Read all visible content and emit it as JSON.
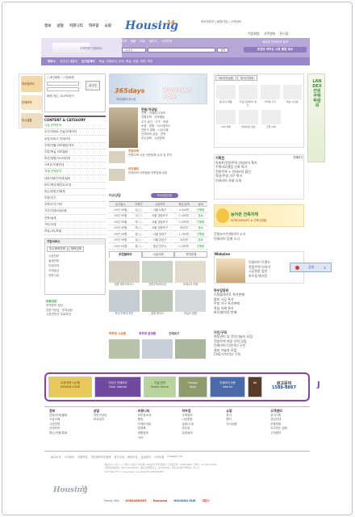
{
  "header": {
    "nav": [
      "정보",
      "상담",
      "커뮤니티",
      "하우징",
      "쇼핑"
    ],
    "top_links": "하우징투어 | 회원가입 | 고객센터",
    "logo_text": "Housing",
    "logo_num": "14",
    "links2": [
      "기업회원",
      "고객센터",
      "전시장"
    ],
    "search_tabs": [
      "자재",
      "샘플",
      "도로",
      "갤러리",
      "시공업체"
    ],
    "search_select": "시공검색",
    "search_button": "검색",
    "band_left": "주택전문 인테리어",
    "band_right_line1": "새로운 인테리어 정보",
    "band_right_line2": "조건만 바꾸는 시장 종합 보수",
    "sub_tabs": [
      "하우스",
      "국내 신 개발지",
      "인기검색어"
    ],
    "sub_keywords": "욕실, 인테리어, 도어, 욕실, 타일, 마루, 벽지"
  },
  "quick": {
    "items": [
      "하우징투어",
      "인테리어",
      "전시샘플"
    ]
  },
  "login": {
    "opt1": "개인회원",
    "opt2": "기업회원",
    "login_btn": "로그인",
    "join": "회원가입",
    "find": "ID/PW찾기"
  },
  "category": {
    "title": "CONTENT & CATEGORY",
    "items": [
      "시공 견적문의",
      "주거/아파트 건설/인테리어",
      "상업/오피스 인테리어",
      "주택/건물 리모델링/개조",
      "주방/욕실 리모델링",
      "외관/정원/익스테리어",
      "스토리 이용안내",
      "자재 견적문의",
      "내부자재/건자재/설비",
      "바닥/벽지/페인트/도장",
      "방수/방한/단열재",
      "조명/전기",
      "주택/주거/기타",
      "가구/인테리어소품",
      "건축/설계",
      "기타/자재",
      "커뮤니티/포럼"
    ]
  },
  "partner": {
    "title": "기업서비스",
    "tabs": [
      "우수협력업체",
      "협력업체"
    ],
    "items": [
      "시공전문",
      "설계전문",
      "인테리어",
      "자재공급",
      "전문시공"
    ]
  },
  "consult": {
    "title": "무료상담",
    "lines": [
      "견적문의 상담",
      "전문가상담 · 투자상담",
      "시공견적서 무료작성"
    ]
  },
  "hero": {
    "title1": "365days",
    "title2": "HOUSING FAIR",
    "sub": "하우징페어 전시장"
  },
  "topsec": {
    "head": "전원/가상담",
    "lines": [
      "건축 · 인테리어 정보",
      "전원주택 · 리모델링",
      "주거 공간 · 가구 · 조명",
      "조경 · 정원 · 익스테리어",
      "전문가 칼럼 · 시공사례",
      "인테리어 상담 · 견적",
      "우수업체 · 시공업체"
    ]
  },
  "sec2": {
    "h1": "전원주택",
    "l1": "전원주택 시공 전문업체 소개 및 견적",
    "h2": "리모델링",
    "l2": "인테리어 리모델링 전문업체 상담"
  },
  "price": {
    "title": "비교상담",
    "badge": "비교상담신청",
    "headers": [
      "공사일시",
      "의뢰인",
      "시공지역",
      "예산/금액",
      "상태"
    ],
    "rows": [
      [
        "09년 09월",
        "김○○",
        "서울 노원구",
        "3,000만",
        "진행중"
      ],
      [
        "09년 09월",
        "이○○",
        "서울 영등포구",
        "1,500만",
        "완료"
      ],
      [
        "09년 09월",
        "박○○",
        "서울 영등포구",
        "2,000만",
        "진행중"
      ],
      [
        "09년 09월",
        "최○○",
        "서울 영등포구",
        "800만",
        "완료"
      ],
      [
        "09년 09월",
        "정○○",
        "서울 송파구",
        "1,200만",
        "진행중"
      ],
      [
        "09년 09월",
        "강○○",
        "서울 강남구",
        "500만",
        "완료"
      ],
      [
        "09년 09월",
        "윤○○",
        "충남 천안시",
        "2,500만",
        "진행중"
      ]
    ]
  },
  "gallery": {
    "tabs": [
      "추천갤러리",
      "시공사례",
      "지역업체"
    ],
    "row1": [
      "정원 레이크하우스",
      "전원주택/하우징",
      "자재나라 모형"
    ],
    "row2": [
      "토지/건축/디자인",
      "정원 레이크",
      "하늘의 정원"
    ]
  },
  "sub2": {
    "h1": "하우징 시공편",
    "h2": "하우징 분양편",
    "more": "전체보기"
  },
  "md": {
    "tabs": [
      "MD추천상품",
      "특가/이벤트"
    ],
    "products": [
      "문/도어 제품",
      "거실 인테리어 세트",
      "사무용 가구",
      "욕실 수납장"
    ],
    "list": [
      "CSD 벽지",
      "붙박이장 세트",
      "조명 LED"
    ]
  },
  "landex": {
    "text": "LANDEX 전원주택박람회"
  },
  "proj": {
    "title": "기획전",
    "more": "전체보기",
    "items": [
      "아파트/전원주택 인테리어 특가",
      "주택리모델링 신축 특가",
      "전원주택 + 인테리어 할인",
      "욕실/주방 가구 특가",
      "인테리어 자재 소개"
    ]
  },
  "ban1": {
    "title": "농어촌 건축자재",
    "sub": "KOREARMART ★ 건축자재몰"
  },
  "news": {
    "items": [
      "건설뉴스/인테리어 소식",
      "인테리어 업계 소식"
    ]
  },
  "webzine": {
    "title": "Webzine",
    "items": [
      "인테리어 트렌드",
      "전원주택 이야기",
      "시공현장 탐방",
      "하우징 매거진"
    ],
    "popup": "공유"
  },
  "trade": {
    "title": "하우징장터",
    "items": [
      "스탈플레이트 특가판매",
      "창호 시공 특가",
      "주방 가구 특가판매",
      "욕실 자재 특가",
      "바닥재/마루 판매"
    ]
  },
  "buy": {
    "title": "구인/구직",
    "items": [
      "현장관리 및 전기기술자 모집",
      "전원주택 현장 인력 모집",
      "인테리어 디자이너 구인",
      "설비 기술자 모집",
      "CAD 디자이너 구직"
    ]
  },
  "ads": [
    {
      "name": "ad1",
      "l1": "고객 만족 시스템",
      "l2": "DESIGN CODE"
    },
    {
      "name": "ad2",
      "l1": "디자인 인테리어",
      "l2": "Color Interior"
    },
    {
      "name": "ad3",
      "l1": "건설 업체",
      "l2": "Ready Home"
    },
    {
      "name": "ad4",
      "l1": "Design",
      "l2": "Style"
    },
    {
      "name": "ad5",
      "l1": "인테리어 전문",
      "l2": "Interior"
    },
    {
      "name": "ad6",
      "l1": "8d",
      "l2": ""
    }
  ],
  "ad_call": {
    "title": "광고문의",
    "phone": "1588-8867"
  },
  "annot": "J",
  "sitemap": [
    {
      "h": "정보",
      "items": [
        "업체/자재/물량",
        "시공사례",
        "시공업체",
        "인테리어",
        "최신/전원/특화"
      ]
    },
    {
      "h": "상담",
      "items": [
        "전문가상담",
        "비교상담"
      ]
    },
    {
      "h": "커뮤니티",
      "items": [
        "하우징소개",
        "증빙",
        "인테리어팁",
        "방명록",
        "생활정보",
        "기타"
      ]
    },
    {
      "h": "하우징",
      "items": [
        "주택정보",
        "시공현장",
        "설계/시공",
        "하우징",
        "분양정보"
      ]
    },
    {
      "h": "쇼핑",
      "items": [
        "특가",
        "행사",
        "전시상품"
      ]
    },
    {
      "h": "고객센터",
      "items": [
        "공지사항",
        "상담안내",
        "이용방법",
        "자주하는 질문",
        "고객센터"
      ]
    }
  ],
  "footer": {
    "links": [
      "회사소개",
      "고객센터",
      "이용약관",
      "개인정보보호정책",
      "광고안내",
      "제휴안내",
      "입점문의",
      "사이트맵",
      "Contact Us"
    ],
    "info": [
      "대표이사: 이○○ | 서울시 강남구 대치동 000번지 하우징빌딩 | 대표전화: 1588-8867 | 팩스: 02-000-0000",
      "사업자등록번호: 000-00-00000 | 통신판매업신고: 제 0000호 | 개인정보관리책임자: 이○○",
      "COPYRIGHT © Housing14 ALL RIGHTS RESERVED"
    ],
    "family_label": "Family Site",
    "family": [
      "KOREARMART",
      "Hanssem",
      "HOUSING FAIR",
      "대한스"
    ]
  }
}
